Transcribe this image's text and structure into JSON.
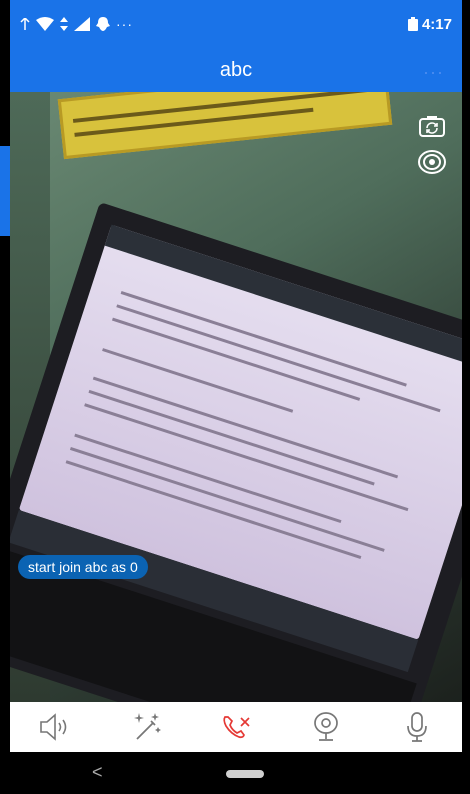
{
  "status_bar": {
    "time": "4:17",
    "more": "···"
  },
  "title_bar": {
    "title": "abc",
    "more": "···"
  },
  "video": {
    "toast": "start join abc as 0"
  },
  "toolbar": {
    "items": [
      {
        "icon": "speaker-icon"
      },
      {
        "icon": "magic-wand-icon"
      },
      {
        "icon": "hangup-icon",
        "color": "#e53935"
      },
      {
        "icon": "camera-icon"
      },
      {
        "icon": "microphone-icon"
      }
    ]
  },
  "nav": {
    "back": "<"
  },
  "colors": {
    "accent": "#1a73e8",
    "hangup": "#e53935",
    "toast": "#0b63b3"
  }
}
